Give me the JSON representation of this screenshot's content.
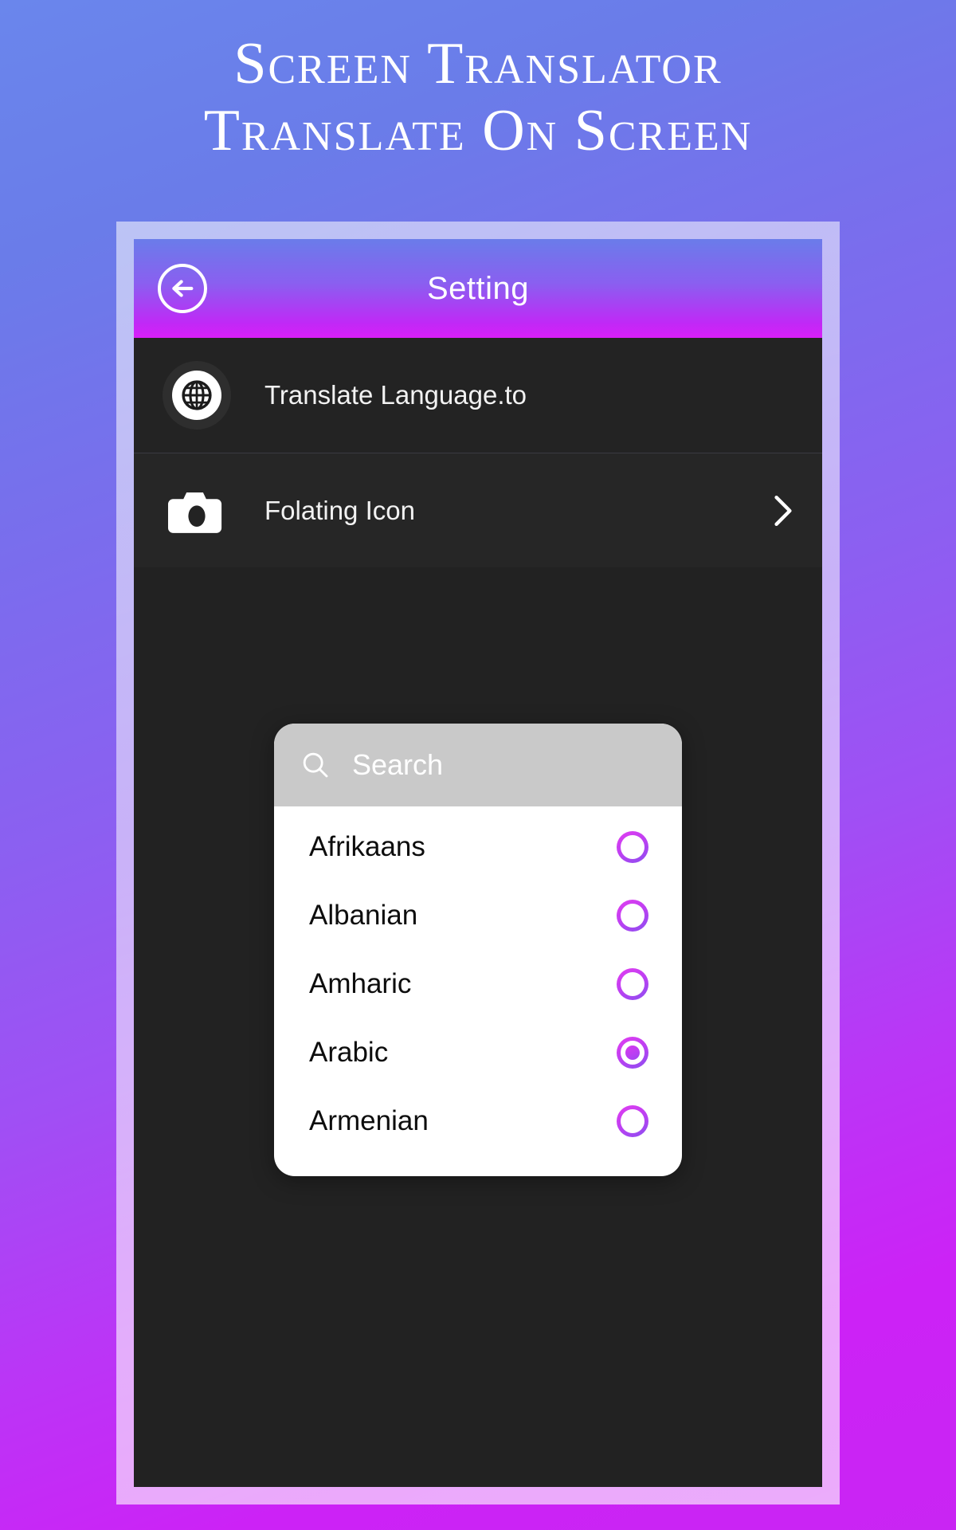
{
  "promo": {
    "headline_line1": "Screen Translator",
    "headline_line2": "Translate On Screen",
    "bg_start_color": "#6a86ec",
    "bg_end_color": "#c925f3",
    "frame_color": "#c3b4f7"
  },
  "app": {
    "header": {
      "title": "Setting",
      "back_icon": "arrow-left-icon",
      "gradient_top": "#6a7cea",
      "gradient_bottom": "#d81ff8"
    },
    "settings_rows": [
      {
        "label": "Translate Language.to",
        "icon": "globe-icon",
        "has_chevron": false
      },
      {
        "label": "Folating Icon",
        "icon": "camera-icon",
        "has_chevron": true,
        "chevron_icon": "chevron-right-icon"
      }
    ],
    "language_dialog": {
      "search": {
        "placeholder": "Search",
        "value": "",
        "icon": "search-icon",
        "background_color": "#c9c9c9"
      },
      "selected_language": "Arabic",
      "accent_color": "#c13ff2",
      "languages": [
        {
          "name": "Afrikaans",
          "selected": false
        },
        {
          "name": "Albanian",
          "selected": false
        },
        {
          "name": "Amharic",
          "selected": false
        },
        {
          "name": "Arabic",
          "selected": true
        },
        {
          "name": "Armenian",
          "selected": false
        }
      ]
    },
    "screen_background_color": "#222222"
  }
}
